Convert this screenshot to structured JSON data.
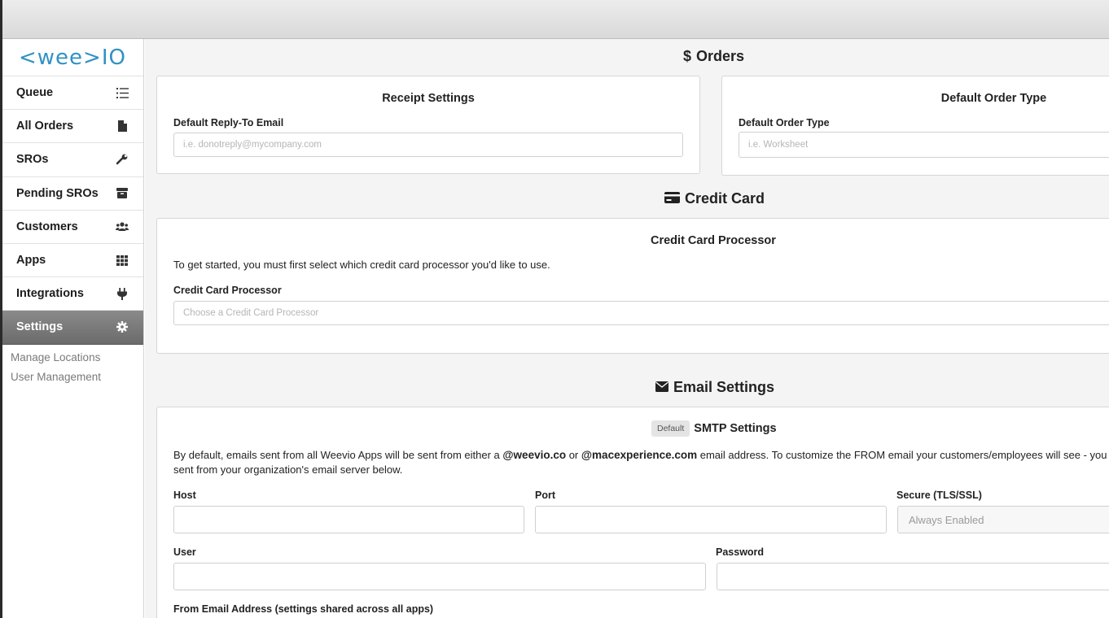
{
  "app": {
    "logo_text": "<wee>IO"
  },
  "sidebar": {
    "items": [
      {
        "label": "Queue",
        "icon": "list-icon"
      },
      {
        "label": "All Orders",
        "icon": "document-icon"
      },
      {
        "label": "SROs",
        "icon": "wrench-icon"
      },
      {
        "label": "Pending SROs",
        "icon": "archive-box-icon"
      },
      {
        "label": "Customers",
        "icon": "users-icon"
      },
      {
        "label": "Apps",
        "icon": "grid-icon"
      },
      {
        "label": "Integrations",
        "icon": "plug-icon"
      },
      {
        "label": "Settings",
        "icon": "gear-icon",
        "active": true
      }
    ],
    "subitems": [
      "Manage Locations",
      "User Management"
    ]
  },
  "orders": {
    "title": "Orders",
    "receipt": {
      "title": "Receipt Settings",
      "reply_label": "Default Reply-To Email",
      "reply_placeholder": "i.e. donotreply@mycompany.com"
    },
    "order_type": {
      "title": "Default Order Type",
      "label": "Default Order Type",
      "placeholder": "i.e. Worksheet"
    }
  },
  "credit_card": {
    "title": "Credit Card",
    "processor": {
      "title": "Credit Card Processor",
      "intro": "To get started, you must first select which credit card processor you'd like to use.",
      "label": "Credit Card Processor",
      "placeholder": "Choose a Credit Card Processor"
    }
  },
  "email": {
    "title": "Email Settings",
    "smtp": {
      "badge": "Default",
      "title": "SMTP Settings",
      "desc_part1": "By default, emails sent from all Weevio Apps will be sent from either a ",
      "domain1": "@weevio.co",
      "desc_or": " or ",
      "domain2": "@macexperience.com",
      "desc_part2": " email address. To customize the FROM email your customers/employees will see - you",
      "desc_line2": "sent from your organization's email server below.",
      "host_label": "Host",
      "port_label": "Port",
      "secure_label": "Secure (TLS/SSL)",
      "secure_value": "Always Enabled",
      "user_label": "User",
      "password_label": "Password",
      "from_label": "From Email Address (settings shared across all apps)"
    }
  }
}
